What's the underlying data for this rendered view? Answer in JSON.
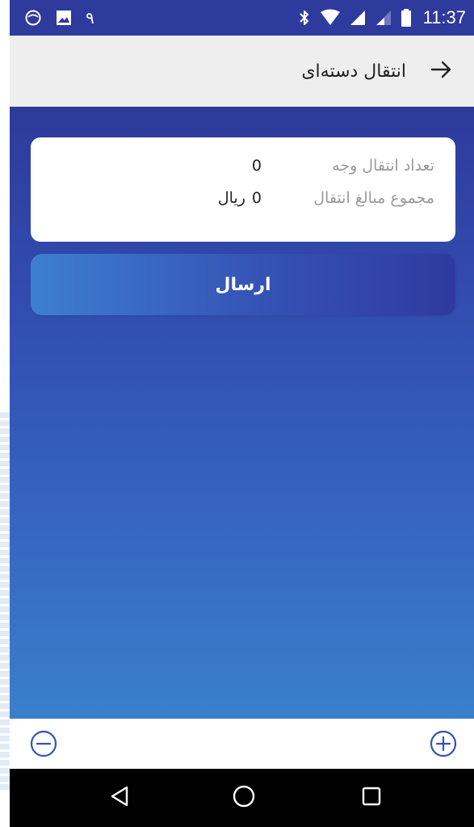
{
  "status_bar": {
    "notification_digit": "۹",
    "time": "11:37",
    "icons": [
      "circle-notification-icon",
      "image-icon",
      "bluetooth-icon",
      "wifi-icon",
      "signal-icon",
      "signal-weak-icon",
      "battery-icon"
    ]
  },
  "app_bar": {
    "title": "انتقال دسته‌ای",
    "back_icon": "arrow-right-icon"
  },
  "summary": {
    "count_label": "تعداد انتقال وجه",
    "count_value": "0",
    "total_label": "مجموع مبالغ انتقال",
    "total_value": "0",
    "currency": "ریال"
  },
  "actions": {
    "send_label": "ارسال"
  },
  "bottom_toolbar": {
    "left_icon": "circle-minus-icon",
    "right_icon": "circle-plus-icon"
  },
  "navigation": {
    "buttons": [
      "back-triangle-icon",
      "home-circle-icon",
      "recents-square-icon"
    ]
  },
  "colors": {
    "primary_dark": "#2e3a9c",
    "primary_light": "#3a7fcd",
    "accent": "#3355b6",
    "card_bg": "#ffffff",
    "label_gray": "#9a9a9a"
  }
}
